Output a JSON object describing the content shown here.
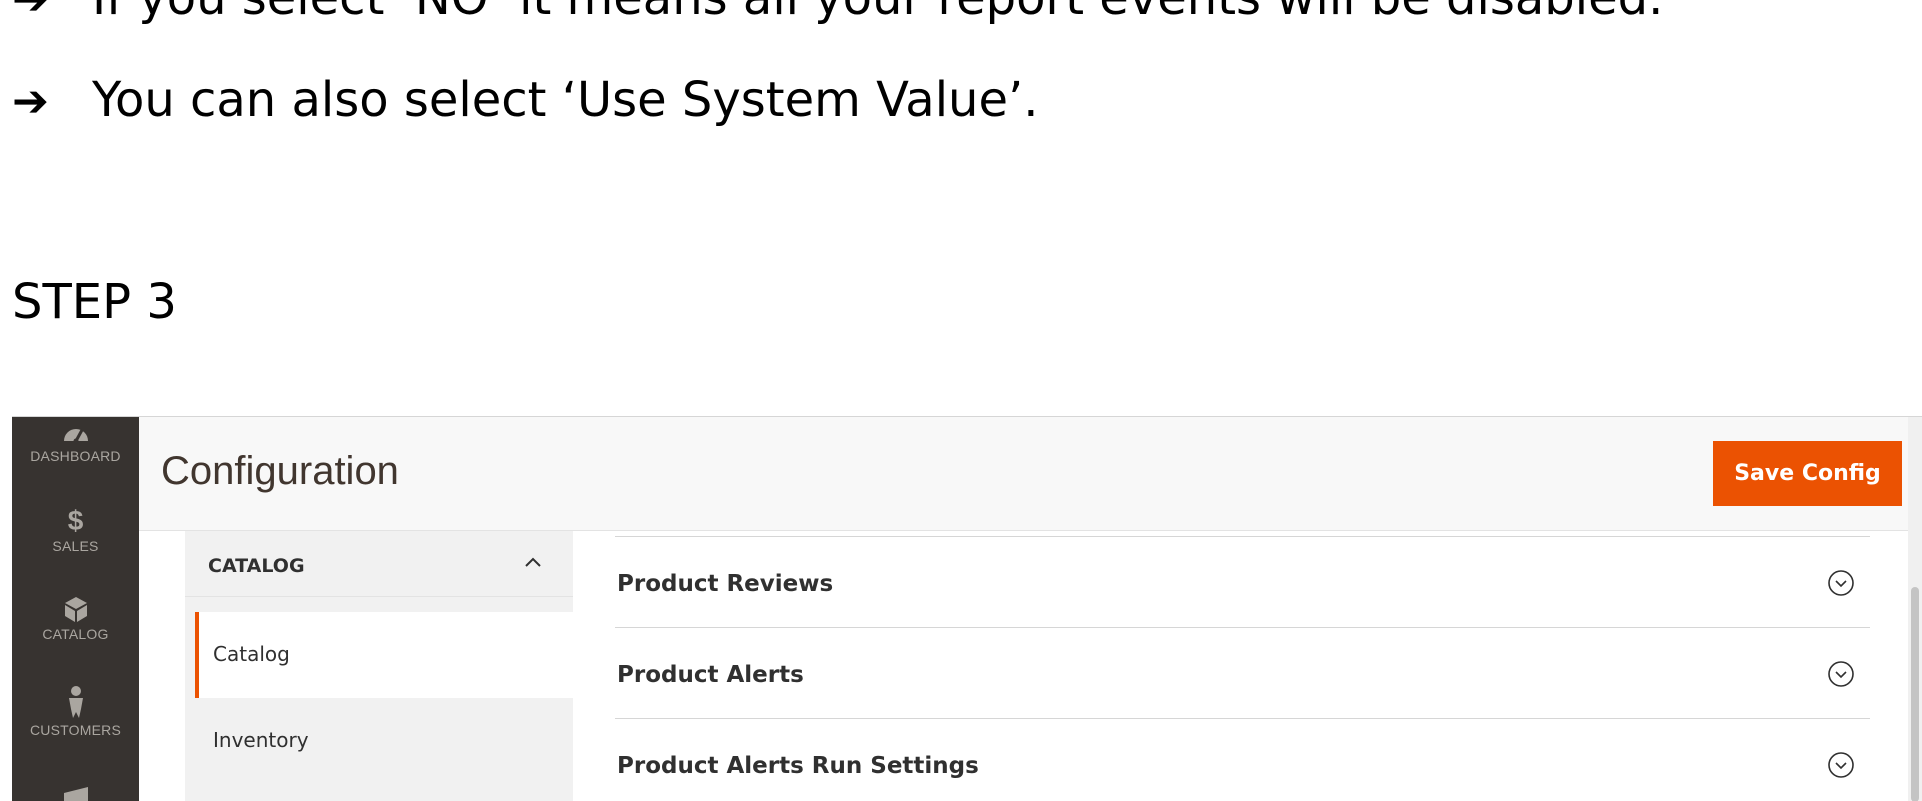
{
  "document": {
    "line1": "If you select ‘NO’ it means all your report events will be disabled.",
    "line2": "You can also select ‘Use System Value’.",
    "arrow": "➔",
    "step_heading": "STEP 3"
  },
  "nav": {
    "items": [
      {
        "label": "DASHBOARD",
        "icon": "dashboard-icon"
      },
      {
        "label": "SALES",
        "icon": "dollar-icon"
      },
      {
        "label": "CATALOG",
        "icon": "cube-icon"
      },
      {
        "label": "CUSTOMERS",
        "icon": "person-icon"
      }
    ]
  },
  "header": {
    "title": "Configuration",
    "save_label": "Save Config"
  },
  "left_panel": {
    "section_title": "CATALOG",
    "items": [
      {
        "label": "Catalog",
        "active": true
      },
      {
        "label": "Inventory",
        "active": false
      }
    ]
  },
  "content": {
    "groups": [
      {
        "title": "Product Reviews"
      },
      {
        "title": "Product Alerts"
      },
      {
        "title": "Product Alerts Run Settings"
      }
    ]
  },
  "colors": {
    "accent": "#eb5202",
    "nav_bg": "#373330",
    "panel_bg": "#f1f1f1"
  }
}
